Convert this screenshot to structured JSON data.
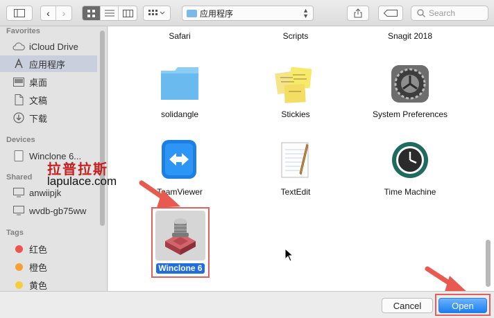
{
  "toolbar": {
    "path_label": "应用程序",
    "search_placeholder": "Search"
  },
  "sidebar": {
    "favorites_title": "Favorites",
    "favorites": [
      {
        "label": "iCloud Drive",
        "icon": "cloud-icon"
      },
      {
        "label": "应用程序",
        "icon": "applications-icon",
        "selected": true
      },
      {
        "label": "桌面",
        "icon": "desktop-icon"
      },
      {
        "label": "文稿",
        "icon": "documents-icon"
      },
      {
        "label": "下载",
        "icon": "downloads-icon"
      }
    ],
    "devices_title": "Devices",
    "devices": [
      {
        "label": "Winclone 6...",
        "icon": "disk-icon"
      }
    ],
    "shared_title": "Shared",
    "shared": [
      {
        "label": "anwiipjk",
        "icon": "computer-icon"
      },
      {
        "label": "wvdb-gb75ww",
        "icon": "computer-icon"
      }
    ],
    "tags_title": "Tags",
    "tags": [
      {
        "label": "红色",
        "color": "#f0524f"
      },
      {
        "label": "橙色",
        "color": "#f6a035"
      },
      {
        "label": "黄色",
        "color": "#f5cd3d"
      }
    ]
  },
  "files": {
    "top_row": [
      "Safari",
      "Scripts",
      "Snagit 2018"
    ],
    "row2": [
      "solidangle",
      "Stickies",
      "System Preferences"
    ],
    "row3": [
      "TeamViewer",
      "TextEdit",
      "Time Machine"
    ],
    "selected": "Winclone 6"
  },
  "watermark": {
    "cn": "拉普拉斯",
    "en": "lapulace.com"
  },
  "buttons": {
    "cancel": "Cancel",
    "open": "Open"
  },
  "colors": {
    "accent": "#1a7ef2",
    "highlight_box": "#e06060",
    "arrow": "#e85a4f"
  }
}
